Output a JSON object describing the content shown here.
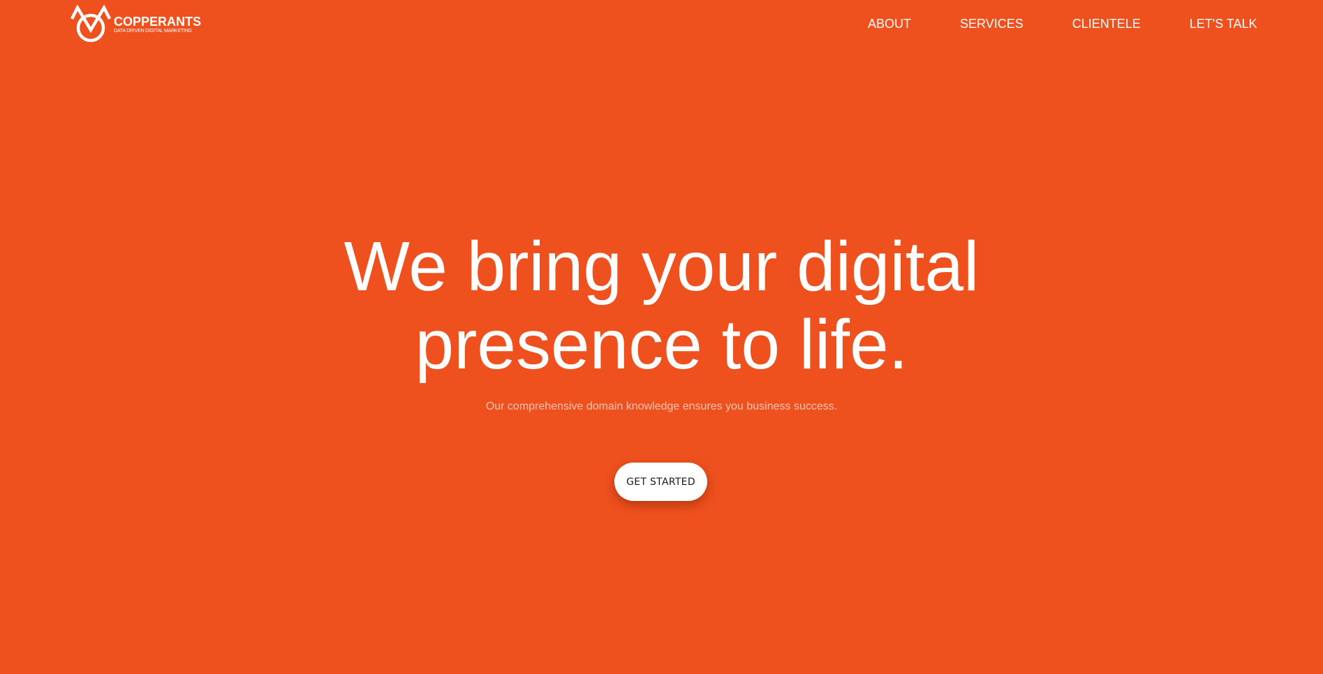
{
  "brand": {
    "name": "COPPERANTS",
    "tagline": "DATA DRIVEN DIGITAL MARKETING",
    "logo_icon": "copperants-logo-icon"
  },
  "nav": {
    "items": [
      {
        "label": "ABOUT"
      },
      {
        "label": "SERVICES"
      },
      {
        "label": "CLIENTELE"
      },
      {
        "label": "LET'S TALK"
      }
    ]
  },
  "hero": {
    "title_line1": "We bring your digital",
    "title_line2": "presence to life.",
    "subtitle": "Our comprehensive domain knowledge ensures you business success.",
    "cta_label": "GET STARTED"
  },
  "colors": {
    "background": "#EE501E",
    "text": "#FFFFFF",
    "subtitle": "#F6C6B3",
    "button_bg": "#FFFFFF",
    "button_text": "#1A1A1A"
  }
}
